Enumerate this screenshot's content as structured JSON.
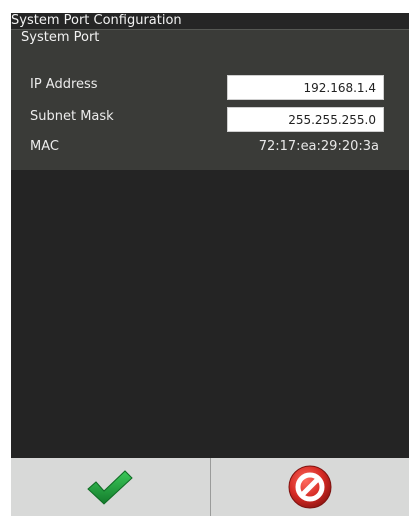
{
  "window": {
    "title": "System Port Configuration"
  },
  "panel": {
    "legend": "System Port",
    "fields": {
      "ip_address": {
        "label": "IP Address",
        "value": "192.168.1.4"
      },
      "subnet_mask": {
        "label": "Subnet Mask",
        "value": "255.255.255.0"
      },
      "mac": {
        "label": "MAC",
        "value": "72:17:ea:29:20:3a"
      }
    }
  },
  "actions": {
    "ok_icon": "checkmark-icon",
    "cancel_icon": "prohibited-icon"
  },
  "colors": {
    "background": "#252525",
    "panel": "#3a3b38",
    "button_bar": "#d8d9d8",
    "ok_green": "#1f9b39",
    "cancel_red": "#d22a25"
  }
}
